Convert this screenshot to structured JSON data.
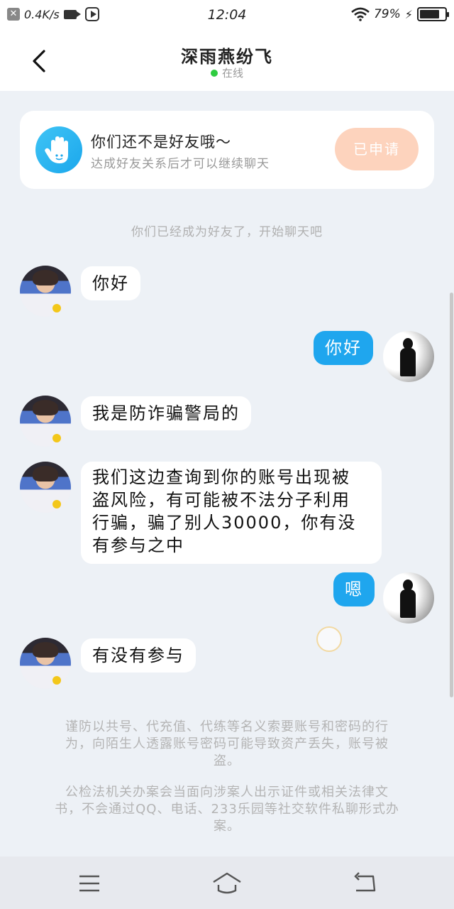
{
  "status_bar": {
    "network_speed": "0.4K/s",
    "time": "12:04",
    "battery_percent": "79%",
    "battery_level": 0.79,
    "icons": [
      "close-notification-icon",
      "video-camera-icon",
      "play-icon",
      "wifi-icon",
      "charging-icon",
      "battery-icon"
    ]
  },
  "header": {
    "title": "深雨燕纷飞",
    "status": "在线",
    "status_color": "#2ecc40"
  },
  "friend_card": {
    "title": "你们还不是好友哦～",
    "subtitle": "达成好友关系后才可以继续聊天",
    "button_label": "已申请",
    "accent": "#fdd3bd"
  },
  "system_note": "你们已经成为好友了，开始聊天吧",
  "messages": [
    {
      "side": "in",
      "text": "你好"
    },
    {
      "side": "out",
      "text": "你好"
    },
    {
      "side": "in",
      "text": "我是防诈骗警局的"
    },
    {
      "side": "in",
      "lines": [
        "我们这边查询到你的账号出现被",
        "盗风险，有可能被不法分子利用",
        "行骗，骗了别人30000，你有没",
        "有参与之中"
      ]
    },
    {
      "side": "out",
      "text": "嗯"
    },
    {
      "side": "in",
      "text": "有没有参与"
    }
  ],
  "warnings": [
    [
      "谨防以共号、代充值、代练等名义索要账号和密码的行",
      "为，向陌生人透露账号密码可能导致资产丢失，账号被",
      "盗。"
    ],
    [
      "公检法机关办案会当面向涉案人出示证件或相关法律文",
      "书，不会通过QQ、电话、233乐园等社交软件私聊形式办",
      "案。"
    ]
  ],
  "nav_bar": {
    "icons": [
      "menu-icon",
      "home-icon",
      "back-icon"
    ]
  },
  "colors": {
    "outgoing_bubble": "#1fa6ee",
    "background": "#edf1f6"
  }
}
